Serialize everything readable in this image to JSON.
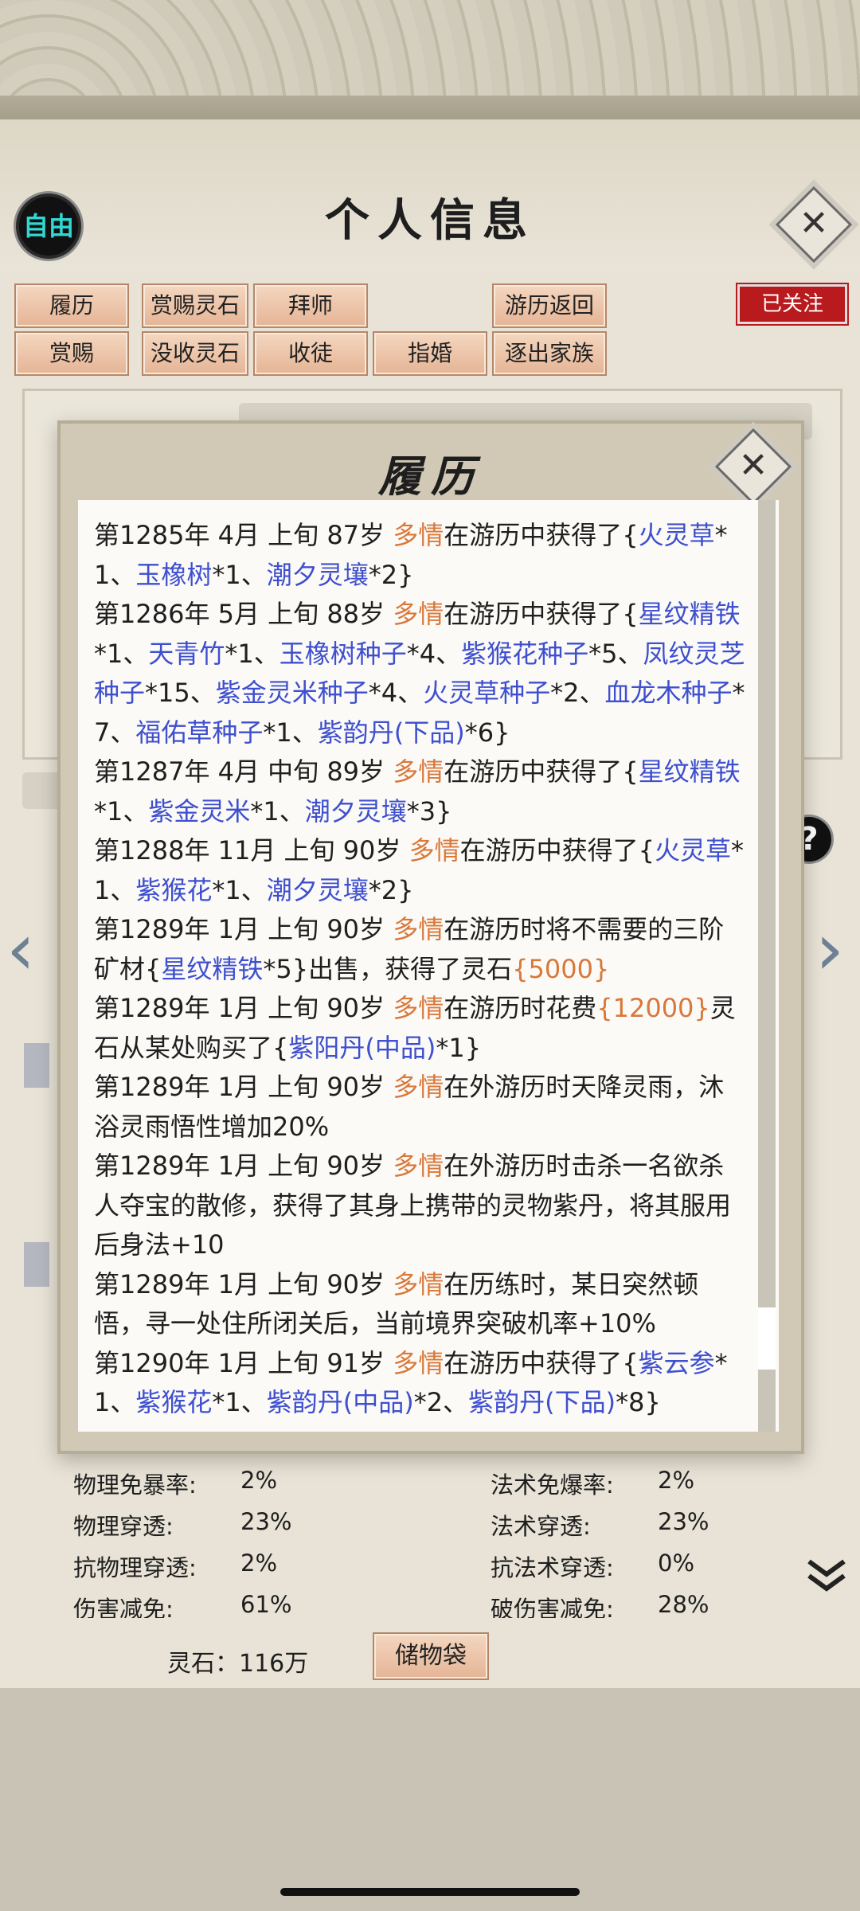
{
  "header": {
    "badge": "自由",
    "title": "个人信息",
    "close_glyph": "✕",
    "followed": "已关注"
  },
  "actions": {
    "row1": [
      "履历",
      "赏赐灵石",
      "拜师",
      "游历返回"
    ],
    "row2": [
      "赏赐",
      "没收灵石",
      "收徒",
      "指婚",
      "逐出家族"
    ]
  },
  "modal": {
    "title": "履历",
    "close_glyph": "✕",
    "entries": [
      {
        "prefix": "第1285年 4月 上旬  87岁  ",
        "name": "多情",
        "segments": [
          {
            "t": "在游历中获得了{"
          },
          {
            "t": "火灵草",
            "c": "it"
          },
          {
            "t": "*1、"
          },
          {
            "t": "玉橡树",
            "c": "it"
          },
          {
            "t": "*1、"
          },
          {
            "t": "潮夕灵壤",
            "c": "it"
          },
          {
            "t": "*2}"
          }
        ]
      },
      {
        "prefix": "第1286年 5月 上旬  88岁  ",
        "name": "多情",
        "segments": [
          {
            "t": "在游历中获得了{"
          },
          {
            "t": "星纹精铁",
            "c": "it"
          },
          {
            "t": "*1、"
          },
          {
            "t": "天青竹",
            "c": "it"
          },
          {
            "t": "*1、"
          },
          {
            "t": "玉橡树种子",
            "c": "it"
          },
          {
            "t": "*4、"
          },
          {
            "t": "紫猴花种子",
            "c": "it"
          },
          {
            "t": "*5、"
          },
          {
            "t": "凤纹灵芝种子",
            "c": "it"
          },
          {
            "t": "*15、"
          },
          {
            "t": "紫金灵米种子",
            "c": "it"
          },
          {
            "t": "*4、"
          },
          {
            "t": "火灵草种子",
            "c": "it"
          },
          {
            "t": "*2、"
          },
          {
            "t": "血龙木种子",
            "c": "it"
          },
          {
            "t": "*7、"
          },
          {
            "t": "福佑草种子",
            "c": "it"
          },
          {
            "t": "*1、"
          },
          {
            "t": "紫韵丹(下品)",
            "c": "it"
          },
          {
            "t": "*6}"
          }
        ]
      },
      {
        "prefix": "第1287年 4月 中旬  89岁  ",
        "name": "多情",
        "segments": [
          {
            "t": "在游历中获得了{"
          },
          {
            "t": "星纹精铁",
            "c": "it"
          },
          {
            "t": "*1、"
          },
          {
            "t": "紫金灵米",
            "c": "it"
          },
          {
            "t": "*1、"
          },
          {
            "t": "潮夕灵壤",
            "c": "it"
          },
          {
            "t": "*3}"
          }
        ]
      },
      {
        "prefix": "第1288年 11月 上旬  90岁  ",
        "name": "多情",
        "segments": [
          {
            "t": "在游历中获得了{"
          },
          {
            "t": "火灵草",
            "c": "it"
          },
          {
            "t": "*1、"
          },
          {
            "t": "紫猴花",
            "c": "it"
          },
          {
            "t": "*1、"
          },
          {
            "t": "潮夕灵壤",
            "c": "it"
          },
          {
            "t": "*2}"
          }
        ]
      },
      {
        "prefix": "第1289年 1月 上旬  90岁  ",
        "name": "多情",
        "segments": [
          {
            "t": "在游历时将不需要的三阶矿材{"
          },
          {
            "t": "星纹精铁",
            "c": "it"
          },
          {
            "t": "*5}出售，获得了灵石"
          },
          {
            "t": "{5000}",
            "c": "nm"
          }
        ]
      },
      {
        "prefix": "第1289年 1月 上旬 90岁  ",
        "name": "多情",
        "segments": [
          {
            "t": "在游历时花费"
          },
          {
            "t": "{12000}",
            "c": "nm"
          },
          {
            "t": "灵石从某处购买了{"
          },
          {
            "t": "紫阳丹(中品)",
            "c": "it"
          },
          {
            "t": "*1}"
          }
        ]
      },
      {
        "prefix": "第1289年 1月 上旬  90岁  ",
        "name": "多情",
        "segments": [
          {
            "t": "在外游历时天降灵雨，沐浴灵雨悟性增加20%"
          }
        ]
      },
      {
        "prefix": "第1289年 1月 上旬  90岁  ",
        "name": "多情",
        "segments": [
          {
            "t": "在外游历时击杀一名欲杀人夺宝的散修，获得了其身上携带的灵物紫丹，将其服用后身法+10"
          }
        ]
      },
      {
        "prefix": "第1289年 1月 上旬  90岁  ",
        "name": "多情",
        "segments": [
          {
            "t": "在历练时，某日突然顿悟，寻一处住所闭关后，当前境界突破机率+10%"
          }
        ]
      },
      {
        "prefix": "第1290年 1月 上旬 91岁  ",
        "name": "多情",
        "segments": [
          {
            "t": "在游历中获得了{"
          },
          {
            "t": "紫云参",
            "c": "it"
          },
          {
            "t": "*1、"
          },
          {
            "t": "紫猴花",
            "c": "it"
          },
          {
            "t": "*1、"
          },
          {
            "t": "紫韵丹(中品)",
            "c": "it"
          },
          {
            "t": "*2、"
          },
          {
            "t": "紫韵丹(下品)",
            "c": "it"
          },
          {
            "t": "*8}"
          }
        ]
      }
    ],
    "scroll_fraction": 0.9
  },
  "stats": [
    {
      "label": "物理免暴率:",
      "value": "2%",
      "label2": "法术免爆率:",
      "value2": "2%"
    },
    {
      "label": "物理穿透:",
      "value": "23%",
      "label2": "法术穿透:",
      "value2": "23%"
    },
    {
      "label": "抗物理穿透:",
      "value": "2%",
      "label2": "抗法术穿透:",
      "value2": "0%"
    },
    {
      "label": "伤害减免:",
      "value": "61%",
      "label2": "破伤害减免:",
      "value2": "28%"
    }
  ],
  "footer": {
    "spirit_stone": "灵石：116万",
    "bag_button": "储物袋"
  },
  "icons": {
    "help": "?",
    "left_arrow": "‹",
    "right_arrow": "›",
    "expand": "chevron-double-down-icon"
  },
  "colors": {
    "name": "#d9783a",
    "item": "#3e4fcf",
    "followed_bg": "#b81a1e",
    "badge_text": "#32d7d2"
  }
}
